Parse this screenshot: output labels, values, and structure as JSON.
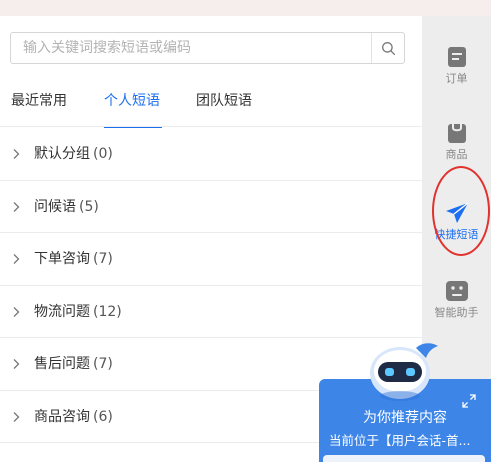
{
  "search": {
    "placeholder": "输入关键词搜索短语或编码"
  },
  "tabs": [
    {
      "label": "最近常用",
      "active": false
    },
    {
      "label": "个人短语",
      "active": true
    },
    {
      "label": "团队短语",
      "active": false
    }
  ],
  "groups": [
    {
      "name": "默认分组",
      "count": "(0)"
    },
    {
      "name": "问候语",
      "count": "(5)"
    },
    {
      "name": "下单咨询",
      "count": "(7)"
    },
    {
      "name": "物流问题",
      "count": "(12)"
    },
    {
      "name": "售后问题",
      "count": "(7)"
    },
    {
      "name": "商品咨询",
      "count": "(6)"
    }
  ],
  "sidebar": {
    "items": [
      {
        "label": "订单",
        "icon": "order-icon",
        "active": false
      },
      {
        "label": "商品",
        "icon": "shopping-bag-icon",
        "active": false
      },
      {
        "label": "快捷短语",
        "icon": "paper-plane-icon",
        "active": true
      },
      {
        "label": "智能助手",
        "icon": "robot-face-icon",
        "active": false
      }
    ]
  },
  "assistant": {
    "title": "为你推荐内容",
    "subtitle": "当前位于【用户会话-首..."
  },
  "colors": {
    "accent": "#1d6ff2",
    "sidebar_bg": "#ededed",
    "card_bg": "#3d86e8",
    "highlight_ring": "#e0332f"
  }
}
